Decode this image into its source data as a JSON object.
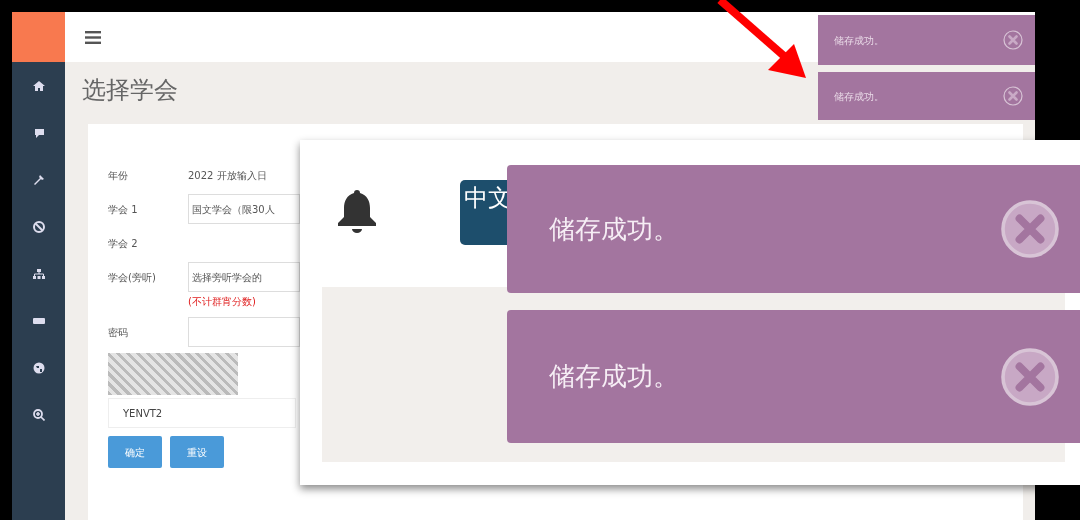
{
  "header": {
    "title": "选择学会"
  },
  "form": {
    "fields": [
      {
        "label": "年份",
        "kind": "text",
        "value": "2022 开放输入日"
      },
      {
        "label": "学会 1",
        "kind": "select",
        "value": "国文学会（限30人"
      },
      {
        "label": "学会 2",
        "kind": "empty"
      },
      {
        "label": "学会(旁听)",
        "kind": "select",
        "value": "选择旁听学会的",
        "note": "(不计群宵分数)"
      },
      {
        "label": "密码",
        "kind": "input"
      }
    ],
    "captcha_input": {
      "value": "YENVT2"
    },
    "buttons": [
      "确定",
      "重设"
    ]
  },
  "notifications": [
    {
      "message": "储存成功。"
    },
    {
      "message": "储存成功。"
    }
  ],
  "zoom_inset": {
    "logo": "中文",
    "notifications": [
      {
        "message": "储存成功。"
      },
      {
        "message": "储存成功。"
      }
    ]
  }
}
